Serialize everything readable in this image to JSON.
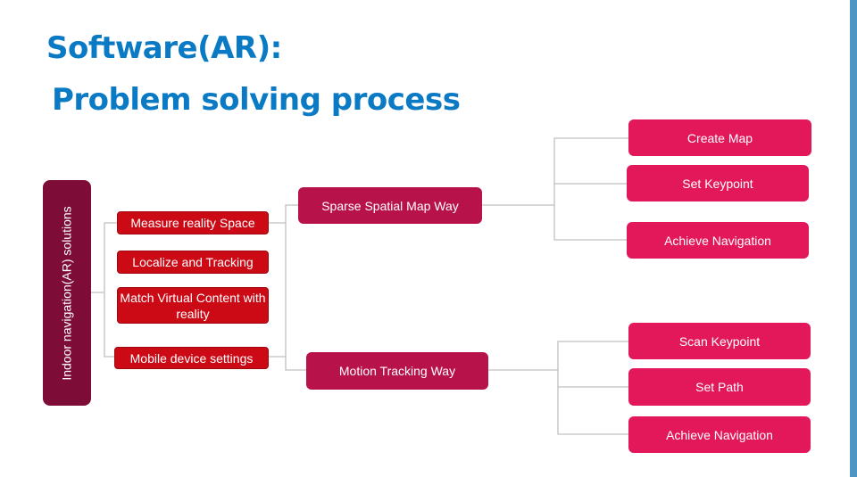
{
  "title": {
    "line1": "Software(AR):",
    "line2": "Problem solving process"
  },
  "colors": {
    "title": "#0a7ac4",
    "root": "#7d0d37",
    "level1": "#cc0a16",
    "level2": "#b8124a",
    "level3": "#e2185b",
    "connector": "#c0c0c0",
    "accent_bar": "#4d96c4"
  },
  "diagram": {
    "root": "Indoor navigation(AR) solutions",
    "requirements": [
      "Measure reality Space",
      "Localize and Tracking",
      "Match Virtual Content with reality",
      "Mobile device settings"
    ],
    "approaches": [
      {
        "label": "Sparse Spatial Map Way",
        "steps": [
          "Create Map",
          "Set Keypoint",
          "Achieve Navigation"
        ]
      },
      {
        "label": "Motion Tracking Way",
        "steps": [
          "Scan Keypoint",
          "Set Path",
          "Achieve Navigation"
        ]
      }
    ]
  }
}
